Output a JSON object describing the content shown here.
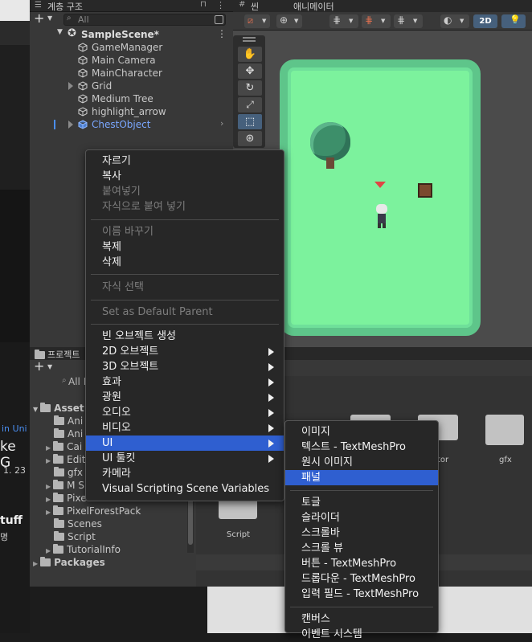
{
  "hierarchy": {
    "tab_label": "계층 구조",
    "search_placeholder": "All",
    "scene_name": "SampleScene*",
    "items": [
      {
        "label": "GameManager"
      },
      {
        "label": "Main Camera"
      },
      {
        "label": "MainCharacter"
      },
      {
        "label": "Grid"
      },
      {
        "label": "Medium Tree"
      },
      {
        "label": "highlight_arrow"
      },
      {
        "label": "ChestObject"
      }
    ]
  },
  "scene": {
    "tab_label": "씬",
    "anim_tab_label": "애니메이터",
    "mode_2d": "2D"
  },
  "project": {
    "tab_label": "프로젝트",
    "search_placeholder": "All P",
    "tree": [
      {
        "label": "Asset"
      },
      {
        "label": "Ani"
      },
      {
        "label": "Ani"
      },
      {
        "label": "Cai"
      },
      {
        "label": "Edit"
      },
      {
        "label": "gfx"
      },
      {
        "label": "M S"
      },
      {
        "label": "Pixe"
      },
      {
        "label": "PixelForestPack"
      },
      {
        "label": "Scenes"
      },
      {
        "label": "Script"
      },
      {
        "label": "TutorialInfo"
      },
      {
        "label": "Packages"
      }
    ],
    "grid_labels": {
      "script": "Script",
      "tor": "tor",
      "gfx": "gfx"
    }
  },
  "left_fragments": {
    "a": "in Uni",
    "b": "ke G",
    "c": "1. 23",
    "d": "tuff",
    "e": "명"
  },
  "context_menu": {
    "items": [
      {
        "label": "자르기",
        "enabled": true
      },
      {
        "label": "복사",
        "enabled": true
      },
      {
        "label": "붙여넣기",
        "enabled": false
      },
      {
        "label": "자식으로 붙여 넣기",
        "enabled": false
      },
      {
        "label": "이름 바꾸기",
        "enabled": false
      },
      {
        "label": "복제",
        "enabled": true
      },
      {
        "label": "삭제",
        "enabled": true
      },
      {
        "label": "자식 선택",
        "enabled": false
      },
      {
        "label": "Set as Default Parent",
        "enabled": false
      },
      {
        "label": "빈 오브젝트 생성",
        "enabled": true
      },
      {
        "label": "2D 오브젝트",
        "enabled": true,
        "submenu": true
      },
      {
        "label": "3D 오브젝트",
        "enabled": true,
        "submenu": true
      },
      {
        "label": "효과",
        "enabled": true,
        "submenu": true
      },
      {
        "label": "광원",
        "enabled": true,
        "submenu": true
      },
      {
        "label": "오디오",
        "enabled": true,
        "submenu": true
      },
      {
        "label": "비디오",
        "enabled": true,
        "submenu": true
      },
      {
        "label": "UI",
        "enabled": true,
        "submenu": true,
        "active": true
      },
      {
        "label": "UI 툴킷",
        "enabled": true,
        "submenu": true
      },
      {
        "label": "카메라",
        "enabled": true
      },
      {
        "label": "Visual Scripting Scene Variables",
        "enabled": true
      }
    ]
  },
  "ui_submenu": {
    "items": [
      {
        "label": "이미지"
      },
      {
        "label": "텍스트 - TextMeshPro"
      },
      {
        "label": "원시 이미지"
      },
      {
        "label": "패널",
        "active": true
      },
      {
        "label": "토글"
      },
      {
        "label": "슬라이더"
      },
      {
        "label": "스크롤바"
      },
      {
        "label": "스크롤 뷰"
      },
      {
        "label": "버튼 - TextMeshPro"
      },
      {
        "label": "드롭다운 - TextMeshPro"
      },
      {
        "label": "입력 필드 - TextMeshPro"
      },
      {
        "label": "캔버스"
      },
      {
        "label": "이벤트 시스템"
      }
    ]
  },
  "colors": {
    "accent": "#2f5fd0",
    "selected_item": "#7aa7ff",
    "grass": "#7cf29d"
  }
}
